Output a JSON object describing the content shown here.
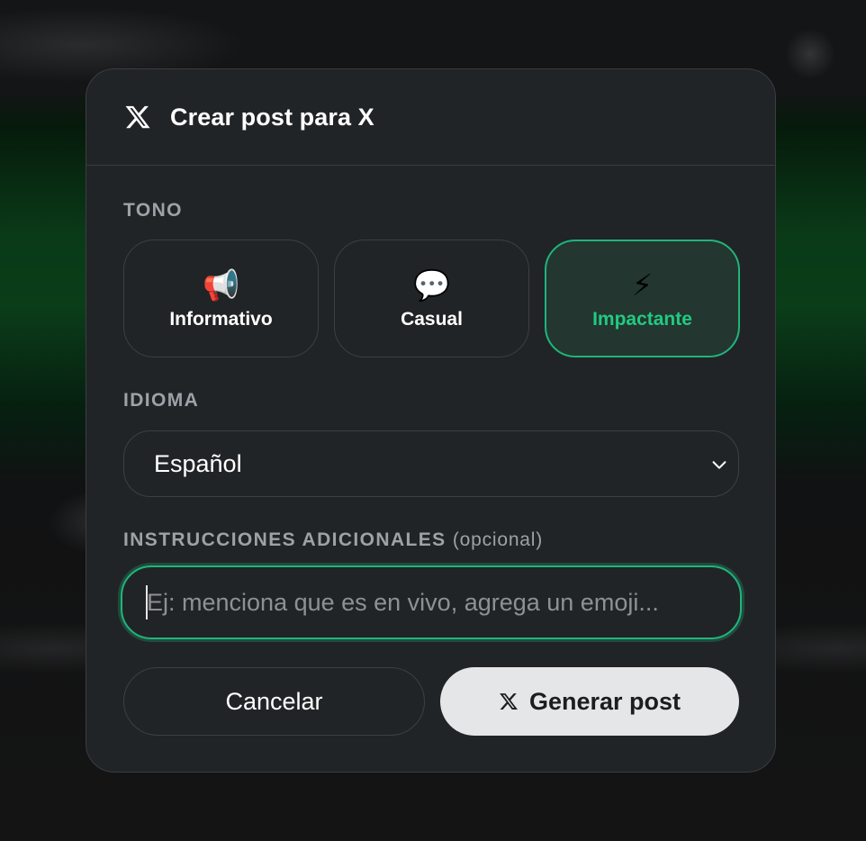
{
  "dialog": {
    "title": "Crear post para X",
    "title_icon": "x-logo-icon"
  },
  "tone": {
    "label": "TONO",
    "options": [
      {
        "emoji": "📢",
        "icon": "megaphone-icon",
        "label": "Informativo",
        "selected": false
      },
      {
        "emoji": "💬",
        "icon": "speech-bubble-icon",
        "label": "Casual",
        "selected": false
      },
      {
        "emoji": "⚡",
        "icon": "lightning-icon",
        "label": "Impactante",
        "selected": true
      }
    ]
  },
  "language": {
    "label": "IDIOMA",
    "selected": "Español",
    "icon": "chevron-down-icon"
  },
  "instructions": {
    "label": "INSTRUCCIONES ADICIONALES",
    "optional": "(opcional)",
    "placeholder": "Ej: menciona que es en vivo, agrega un emoji...",
    "value": ""
  },
  "actions": {
    "cancel_label": "Cancelar",
    "generate_label": "Generar post",
    "generate_icon": "x-logo-icon"
  },
  "colors": {
    "accent": "#1fb57c",
    "accent_text": "#22c983",
    "modal_bg": "#212426",
    "primary_button_bg": "#e5e6e8"
  }
}
